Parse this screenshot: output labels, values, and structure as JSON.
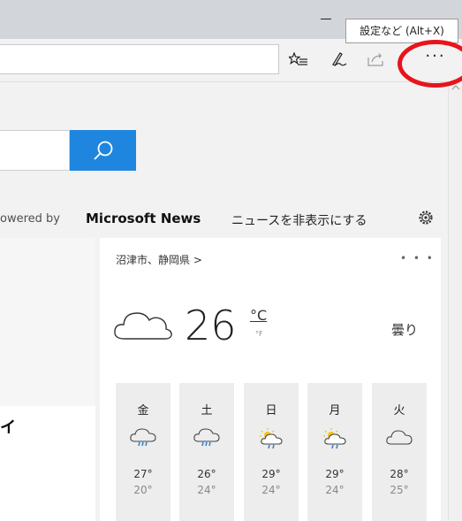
{
  "tooltip": "設定など (Alt+X)",
  "toolbar": {
    "more_label": "···"
  },
  "news": {
    "powered_prefix": "owered by",
    "brand": "Microsoft News",
    "hide_link": "ニュースを非表示にする",
    "card_text": "イ"
  },
  "weather": {
    "location": "沼津市、静岡県 >",
    "menu": "• • •",
    "temperature": "26",
    "unit_c": "°C",
    "unit_f": "°F",
    "condition": "曇り",
    "days": [
      {
        "name": "金",
        "icon": "cloud-rain-icon",
        "high": "27°",
        "low": "20°"
      },
      {
        "name": "土",
        "icon": "cloud-rain-icon",
        "high": "26°",
        "low": "24°"
      },
      {
        "name": "日",
        "icon": "sun-cloud-rain-icon",
        "high": "29°",
        "low": "24°"
      },
      {
        "name": "月",
        "icon": "sun-cloud-rain-icon",
        "high": "29°",
        "low": "24°"
      },
      {
        "name": "火",
        "icon": "cloud-icon",
        "high": "28°",
        "low": "25°"
      }
    ]
  },
  "colors": {
    "accent": "#1f86df",
    "annotation": "#e8141b"
  }
}
